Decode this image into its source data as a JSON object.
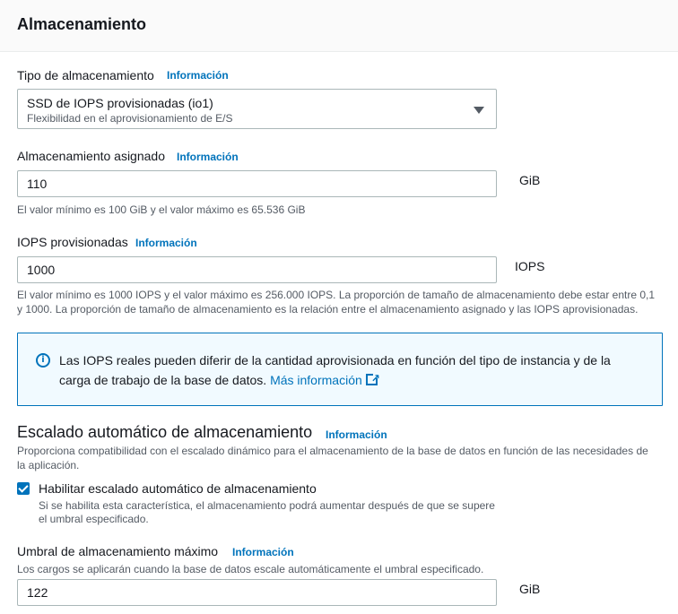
{
  "panel": {
    "title": "Almacenamiento"
  },
  "storage_type": {
    "label": "Tipo de almacenamiento",
    "info": "Información",
    "selected_main": "SSD de IOPS provisionadas (io1)",
    "selected_sub": "Flexibilidad en el aprovisionamiento de E/S"
  },
  "allocated_storage": {
    "label": "Almacenamiento asignado",
    "info": "Información",
    "value": "110",
    "unit": "GiB",
    "help": "El valor mínimo es 100 GiB y el valor máximo es 65.536 GiB"
  },
  "provisioned_iops": {
    "label": "IOPS provisionadas",
    "info": "Información",
    "value": "1000",
    "unit": "IOPS",
    "help_line1": "El valor mínimo es 1000 IOPS y el valor máximo es 256.000 IOPS. La proporción de tamaño de almacenamiento debe estar entre 0,1",
    "help_line2": "y 1000. La proporción de tamaño de almacenamiento es la relación entre el almacenamiento asignado y las IOPS aprovisionadas."
  },
  "alert": {
    "text_line1": "Las IOPS reales pueden diferir de la cantidad aprovisionada en función del tipo de instancia y de la",
    "text_line2": "carga de trabajo de la base de datos.",
    "link": "Más información"
  },
  "autoscaling": {
    "title": "Escalado automático de almacenamiento",
    "info": "Información",
    "desc_line1": "Proporciona compatibilidad con el escalado dinámico para el almacenamiento de la base de datos en función de las necesidades de",
    "desc_line2": "la aplicación.",
    "checkbox_label": "Habilitar escalado automático de almacenamiento",
    "checkbox_checked": true,
    "checkbox_desc_line1": "Si se habilita esta característica, el almacenamiento podrá aumentar después de que se supere",
    "checkbox_desc_line2": "el umbral especificado."
  },
  "max_threshold": {
    "label": "Umbral de almacenamiento máximo",
    "info": "Información",
    "desc": "Los cargos se aplicarán cuando la base de datos escale automáticamente el umbral especificado.",
    "value": "122",
    "unit": "GiB"
  }
}
